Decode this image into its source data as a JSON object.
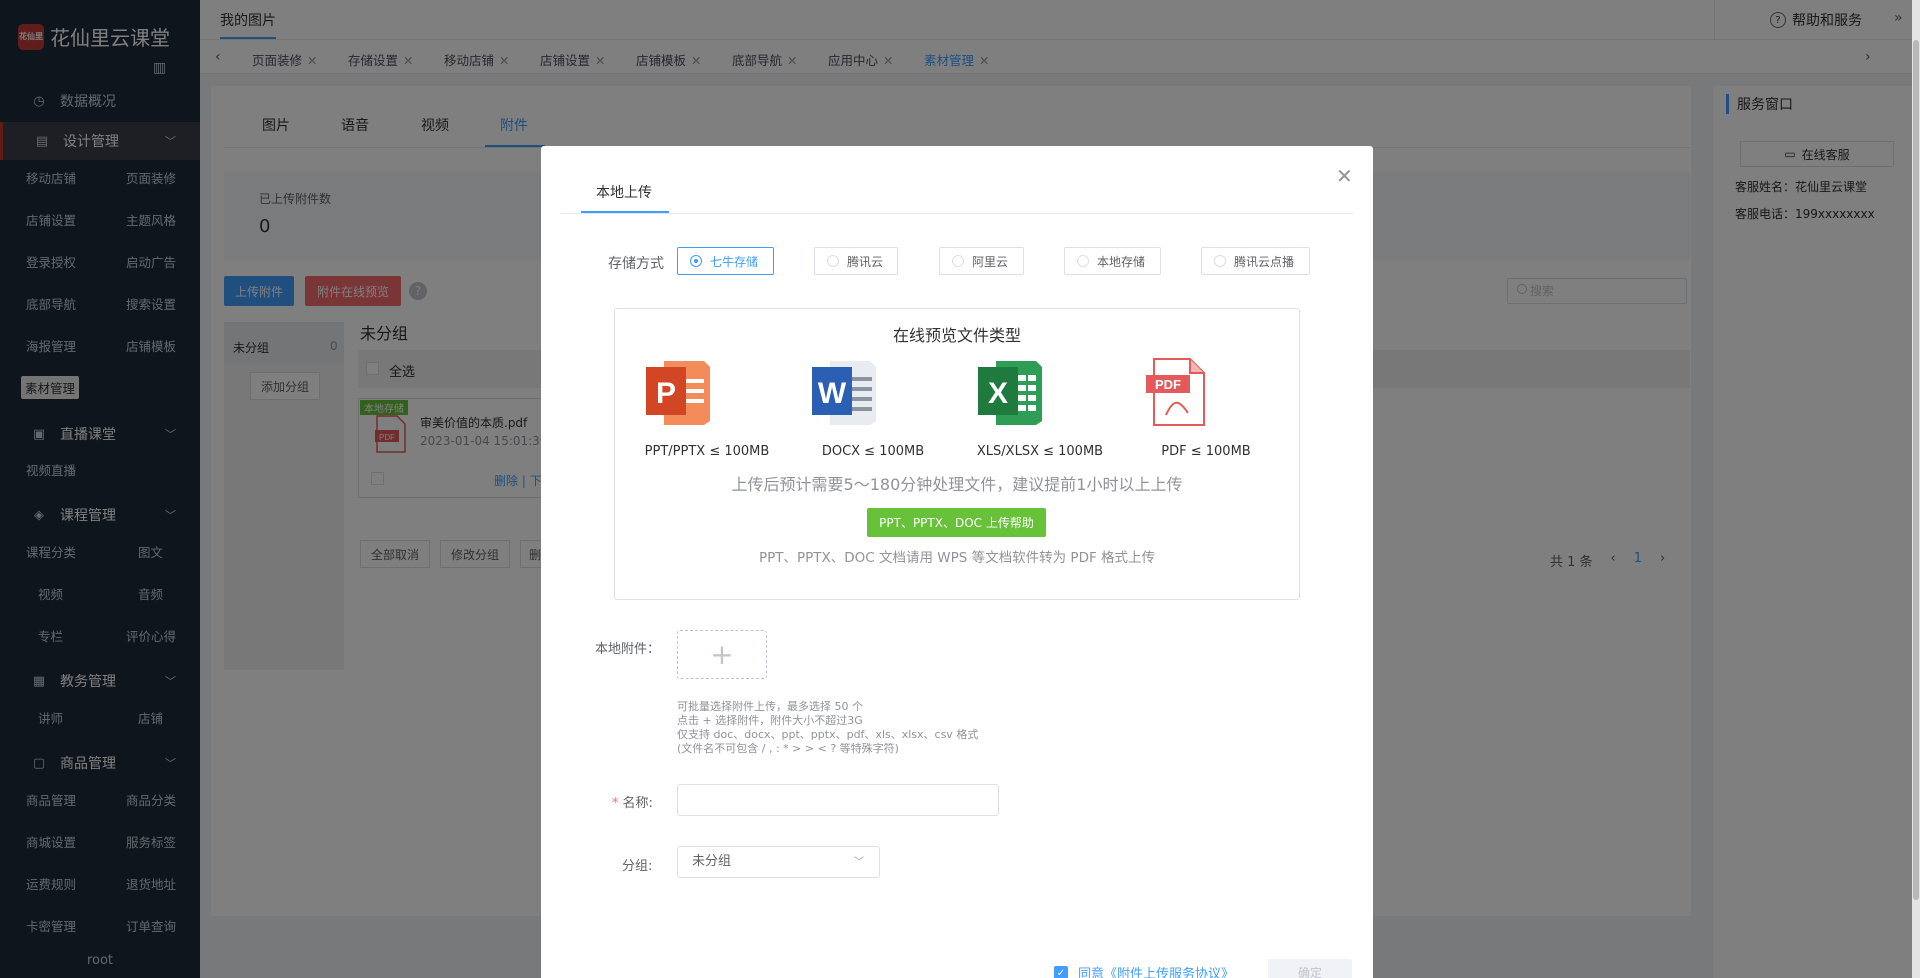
{
  "brand": {
    "name": "花仙里云课堂",
    "mark": "花仙里"
  },
  "sidebar": {
    "groups": [
      {
        "label": "数据概况",
        "icon": "clock-icon"
      },
      {
        "label": "设计管理",
        "icon": "design-icon"
      },
      {
        "label": "直播课堂",
        "icon": "live-icon"
      },
      {
        "label": "课程管理",
        "icon": "graduation-icon"
      },
      {
        "label": "教务管理",
        "icon": "calendar-icon"
      },
      {
        "label": "商品管理",
        "icon": "box-icon"
      }
    ],
    "design_items": [
      "移动店铺",
      "页面装修",
      "店铺设置",
      "主题风格",
      "登录授权",
      "启动广告",
      "底部导航",
      "搜索设置",
      "海报管理",
      "店铺模板",
      "素材管理"
    ],
    "live_items": [
      "视频直播"
    ],
    "course_items": [
      "课程分类",
      "图文",
      "视频",
      "音频",
      "专栏",
      "评价心得"
    ],
    "edu_items": [
      "讲师",
      "店铺"
    ],
    "goods_items": [
      "商品管理",
      "商品分类",
      "商城设置",
      "服务标签",
      "运费规则",
      "退货地址",
      "卡密管理",
      "订单查询"
    ],
    "user": "root"
  },
  "topbar": {
    "title": "我的图片",
    "help": "帮助和服务"
  },
  "tabs": [
    "页面装修",
    "存储设置",
    "移动店铺",
    "店铺设置",
    "店铺模板",
    "底部导航",
    "应用中心",
    "素材管理"
  ],
  "content": {
    "tabs": [
      "图片",
      "语音",
      "视频",
      "附件"
    ],
    "stat_label": "已上传附件数",
    "stat_value": "0",
    "upload_btn": "上传附件",
    "preview_btn": "附件在线预览",
    "search_placeholder": "搜索",
    "group_name": "未分组",
    "group_count": "0",
    "add_group": "添加分组",
    "list_title": "未分组",
    "select_all": "全选",
    "file": {
      "tag": "本地存储",
      "name": "审美价值的本质.pdf",
      "date": "2023-01-04 15:01:39",
      "delete": "删除",
      "download": "下"
    },
    "ops": [
      "全部取消",
      "修改分组",
      "删"
    ],
    "pager": {
      "total": "共 1 条",
      "prev": "‹",
      "current": "1",
      "next": "›"
    }
  },
  "service": {
    "title": "服务窗口",
    "button": "在线客服",
    "name": "客服姓名：花仙里云课堂",
    "tel": "客服电话：199xxxxxxxx"
  },
  "modal": {
    "tab": "本地上传",
    "storage_label": "存储方式",
    "storage_options": [
      "七牛存储",
      "腾讯云",
      "阿里云",
      "本地存储",
      "腾讯云点播"
    ],
    "selected_storage": "七牛存储",
    "preview_title": "在线预览文件类型",
    "file_types": [
      {
        "icon": "ppt-icon",
        "letter": "P",
        "label": "PPT/PPTX ≤ 100MB",
        "color": "#e0522b"
      },
      {
        "icon": "word-icon",
        "letter": "W",
        "label": "DOCX ≤ 100MB",
        "color": "#2b5fb4"
      },
      {
        "icon": "excel-icon",
        "letter": "X",
        "label": "XLS/XLSX ≤ 100MB",
        "color": "#1f8a44"
      },
      {
        "icon": "pdf-icon",
        "letter": "PDF",
        "label": "PDF ≤ 100MB",
        "color": "#e35a5a"
      }
    ],
    "process_note": "上传后预计需要5～180分钟处理文件，建议提前1小时以上上传",
    "help_btn": "PPT、PPTX、DOC 上传帮助",
    "tip": "PPT、PPTX、DOC 文档请用 WPS 等文档软件转为 PDF 格式上传",
    "attachment_label": "本地附件：",
    "hints": [
      "可批量选择附件上传，最多选择 50 个",
      "点击 + 选择附件，附件大小不超过3G",
      "仅支持 doc、docx、ppt、pptx、pdf、xls、xlsx、csv 格式",
      "(文件名不可包含 / , : * > > < ? 等特殊字符)"
    ],
    "name_label": "名称:",
    "group_label": "分组:",
    "group_value": "未分组",
    "agree_text": "同意",
    "agree_link": "《附件上传服务协议》",
    "ok": "确定"
  }
}
